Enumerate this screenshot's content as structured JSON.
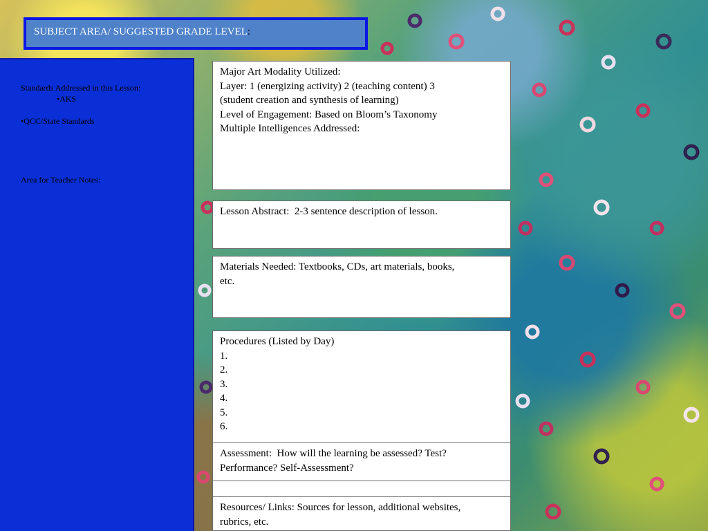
{
  "header": {
    "title": "SUBJECT AREA/ SUGGESTED GRADE LEVEL",
    "title_colon": ":"
  },
  "sidebar": {
    "standards_heading": "Standards Addressed in this Lesson:",
    "aks_item": "•AKS",
    "qcc_item": "•QCC/State Standards",
    "teacher_notes_label": "Area for Teacher Notes:"
  },
  "modality_box": {
    "line1": "Major Art Modality Utilized:",
    "line2": "Layer: 1 (energizing activity) 2 (teaching content) 3",
    "line3": "(student creation and synthesis of learning)",
    "line4": "Level of Engagement: Based on Bloom’s Taxonomy",
    "line5": "Multiple Intelligences Addressed:"
  },
  "abstract_box": {
    "line1": "Lesson Abstract:  2-3 sentence description of lesson."
  },
  "materials_box": {
    "line1": "Materials Needed: Textbooks, CDs, art materials, books,",
    "line2": "etc."
  },
  "procedures_box": {
    "heading": "Procedures (Listed by Day)",
    "items": [
      "1.",
      "2.",
      "3.",
      "4.",
      "5.",
      "6."
    ]
  },
  "assessment_box": {
    "line1": "Assessment:  How will the learning be assessed? Test?",
    "line2": "Performance? Self-Assessment?"
  },
  "resources_box": {
    "line1": "Resources/ Links: Sources for lesson, additional websites,",
    "line2": "rubrics, etc."
  },
  "colors": {
    "title_bar_fill": "#4f82c9",
    "title_bar_border": "#0a16e6",
    "sidebar_fill": "#0b2fd6",
    "box_fill": "#ffffff"
  }
}
